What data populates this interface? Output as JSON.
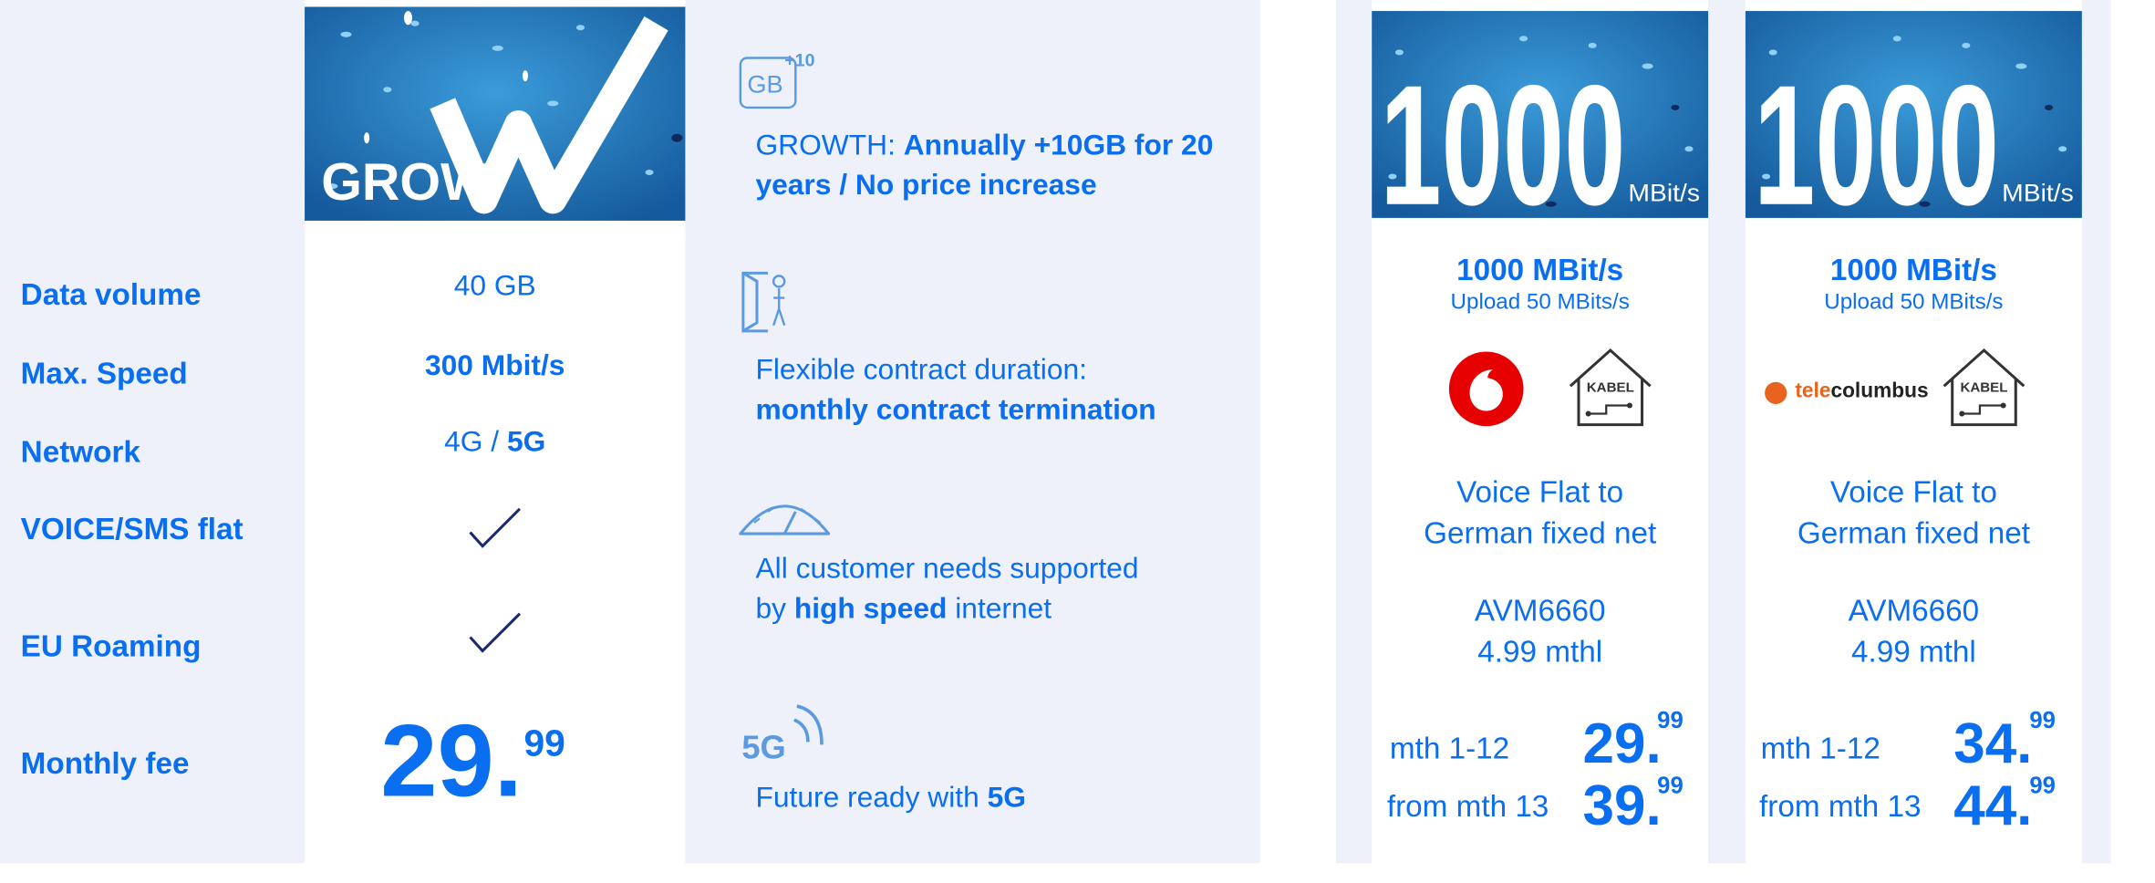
{
  "rows": {
    "labels": [
      "Data volume",
      "Max. Speed",
      "Network",
      "VOICE/SMS flat",
      "EU Roaming",
      "Monthly fee"
    ]
  },
  "grow": {
    "banner_text": "GROW",
    "data_volume": "40 GB",
    "max_speed": "300 Mbit/s",
    "network_prefix": "4G / ",
    "network_bold": "5G",
    "price_main": "29.",
    "price_cents": "99"
  },
  "features": {
    "gb_icon_text": "GB",
    "gb_icon_plus": "+10",
    "growth_prefix": "GROWTH: ",
    "growth_bold": "Annually +10GB for 20 years / No price increase",
    "flex_line1": "Flexible contract duration:",
    "flex_bold": "monthly contract termination",
    "speed_line1": "All customer needs supported",
    "speed_prefix": "by ",
    "speed_bold": "high speed",
    "speed_suffix": " internet",
    "fiveg_icon_text": "5G",
    "future_prefix": "Future ready with ",
    "future_bold": "5G"
  },
  "offers": [
    {
      "banner_number": "1000",
      "banner_unit": "MBit/s",
      "speed": "1000 MBit/s",
      "upload": "Upload 50 MBits/s",
      "provider_logo": "vodafone-logo",
      "kabel_label": "KABEL",
      "voice_line1": "Voice Flat to",
      "voice_line2": "German fixed net",
      "router": "AVM6660",
      "router_price": "4.99 mthl",
      "tier1_label": "mth 1-12",
      "tier1_price": "29.",
      "tier1_cents": "99",
      "tier2_label": "from mth 13",
      "tier2_price": "39.",
      "tier2_cents": "99"
    },
    {
      "banner_number": "1000",
      "banner_unit": "MBit/s",
      "speed": "1000 MBit/s",
      "upload": "Upload 50 MBits/s",
      "provider_logo": "telecolumbus-logo",
      "provider_name_a": "tele",
      "provider_name_b": "columbus",
      "kabel_label": "KABEL",
      "voice_line1": "Voice Flat to",
      "voice_line2": "German fixed net",
      "router": "AVM6660",
      "router_price": "4.99 mthl",
      "tier1_label": "mth 1-12",
      "tier1_price": "34.",
      "tier1_cents": "99",
      "tier2_label": "from mth 13",
      "tier2_price": "44.",
      "tier2_cents": "99"
    }
  ],
  "colors": {
    "accent": "#0a6ef0",
    "panel_bg": "#eef1fa",
    "banner_bg": "#1a6fb8",
    "check": "#1a2a6e",
    "vodafone_red": "#e60000",
    "telecolumbus_orange": "#e8641e"
  }
}
